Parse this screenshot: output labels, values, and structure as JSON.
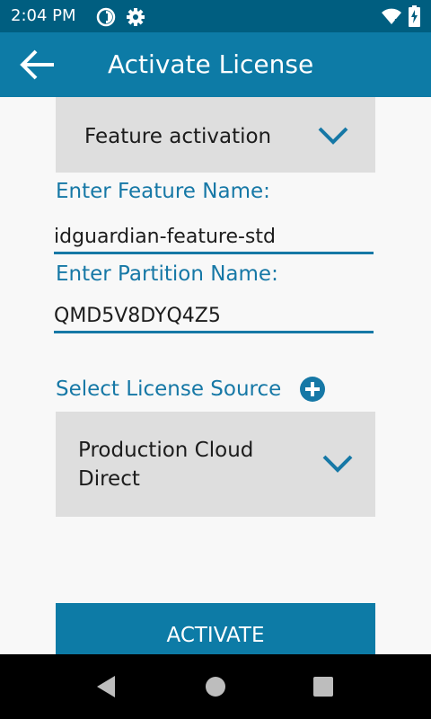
{
  "status_bar": {
    "time": "2:04 PM",
    "icons": [
      "data-saver-icon",
      "settings-gear-icon",
      "wifi-icon",
      "battery-charging-icon"
    ]
  },
  "app_bar": {
    "title": "Activate License",
    "back_icon": "arrow-back-icon"
  },
  "activation_type": {
    "selected": "Feature activation"
  },
  "feature_name": {
    "label": "Enter Feature Name:",
    "value": "idguardian-feature-std"
  },
  "partition_name": {
    "label": "Enter Partition Name:",
    "value": "QMD5V8DYQ4Z5"
  },
  "license_source": {
    "label": "Select License Source",
    "selected": "Production Cloud Direct",
    "add_icon": "add-circle-icon"
  },
  "activate_button": {
    "label": "ACTIVATE"
  },
  "nav_bar": {
    "icons": [
      "back-triangle-icon",
      "home-circle-icon",
      "recents-square-icon"
    ]
  },
  "colors": {
    "status_bar": "#005e80",
    "app_bar": "#0d7ba6",
    "accent": "#1678a6",
    "background": "#f8f8f8",
    "dropdown": "#dedede",
    "nav_bar": "#000000"
  }
}
